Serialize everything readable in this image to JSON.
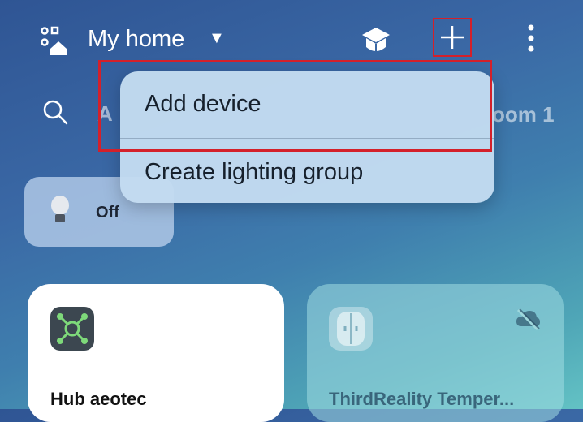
{
  "header": {
    "home_name": "My home",
    "caret": "▼"
  },
  "tabs": {
    "partial_first": "A",
    "partial_room": "oom 1"
  },
  "quick_action": {
    "label": "Off"
  },
  "devices": [
    {
      "name": "Hub aeotec"
    },
    {
      "name": "ThirdReality Temper..."
    }
  ],
  "add_menu": {
    "items": [
      {
        "label": "Add device"
      },
      {
        "label": "Create lighting group"
      }
    ]
  },
  "colors": {
    "highlight": "#d4202a",
    "hub_icon_bg": "#3c4750",
    "hub_icon_fg": "#7ed97a"
  }
}
